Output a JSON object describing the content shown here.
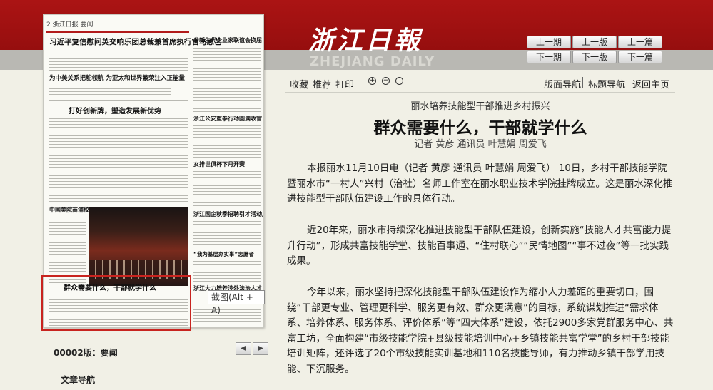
{
  "brand": {
    "logo_cn": "浙江日報",
    "logo_en": "ZHEJIANG DAILY"
  },
  "nav": {
    "prev_issue": "上一期",
    "next_issue": "下一期",
    "prev_page": "上一版",
    "next_page": "下一版",
    "prev_article": "上一篇",
    "next_article": "下一篇"
  },
  "paper_thumb": {
    "header": "2 浙江日报 要闻",
    "headlines": [
      "习近平复信慰问英交响乐团总裁兼首席执行官马思艺",
      "省新生代企业家联谊会换届",
      "为中美关系把舵领航 为亚太和世界繁荣注入正能量",
      "打好创新牌，塑造发展新优势",
      "浙江公安重拳行动圆满收官",
      "女排世俱杯下月开赛",
      "中国美院商浦校区",
      "浙江国企秋季招聘引才活动启幕",
      "“我为基层办实事”志愿者",
      "群众需要什么，干部就学什么",
      "浙江大力培养涉外法治人才"
    ],
    "screenshot_tip": "截图(Alt + A)"
  },
  "edition": {
    "label": "00002版：要闻",
    "prev": "◀",
    "next": "▶"
  },
  "article_nav": {
    "title": "文章导航"
  },
  "toolbar": {
    "favorite": "收藏",
    "recommend": "推荐",
    "print": "打印",
    "zoom_in": "+",
    "zoom_out": "−",
    "zoom_reset": "",
    "layout_nav": "版面导航",
    "title_nav": "标题导航",
    "home": "返回主页"
  },
  "article": {
    "subtitle": "丽水培养技能型干部推进乡村振兴",
    "title": "群众需要什么，干部就学什么",
    "byline": "记者 黄彦 通讯员 叶慧娟 周爱飞",
    "paragraphs": [
      "本报丽水11月10日电（记者 黄彦 通讯员 叶慧娟 周爱飞） 10日，乡村干部技能学院暨丽水市“一村人”兴村（治社）名师工作室在丽水职业技术学院挂牌成立。这是丽水深化推进技能型干部队伍建设工作的具体行动。",
      "近20年来，丽水市持续深化推进技能型干部队伍建设，创新实施“技能人才共富能力提升行动”，形成共富技能学堂、技能百事通、“住村联心”“民情地图”“事不过夜”等一批实践成果。",
      "今年以来，丽水坚持把深化技能型干部队伍建设作为缩小人力差距的重要切口，围绕“干部更专业、管理更科学、服务更有效、群众更满意”的目标，系统谋划推进“需求体系、培养体系、服务体系、评价体系”等“四大体系”建设，依托2900多家党群服务中心、共富工坊，全面构建“市级技能学院+县级技能培训中心+乡镇技能共富学堂”的乡村干部技能培训矩阵，还评选了20个市级技能实训基地和110名技能导师，有力推动乡镇干部学用技能、下沉服务。"
    ]
  }
}
